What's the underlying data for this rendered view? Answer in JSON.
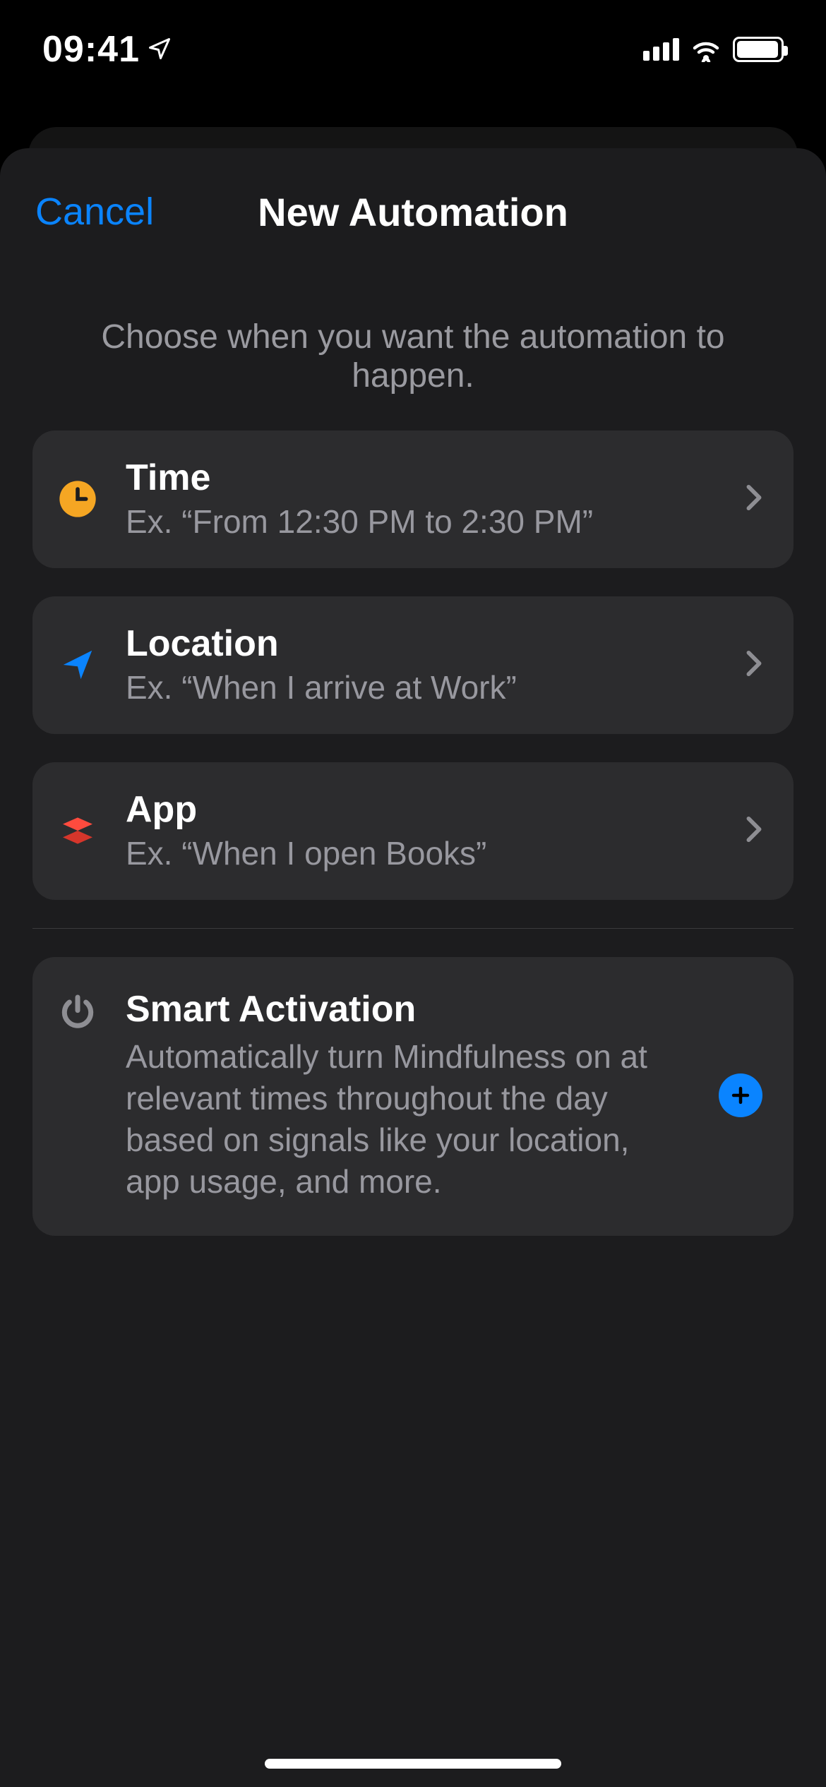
{
  "status": {
    "time": "09:41"
  },
  "nav": {
    "cancel": "Cancel",
    "title": "New Automation"
  },
  "header": "Choose when you want the automation to happen.",
  "rows": {
    "time": {
      "title": "Time",
      "sub": "Ex. “From 12:30 PM to 2:30 PM”"
    },
    "location": {
      "title": "Location",
      "sub": "Ex. “When I arrive at Work”"
    },
    "app": {
      "title": "App",
      "sub": "Ex. “When I open Books”"
    }
  },
  "smart": {
    "title": "Smart Activation",
    "desc": "Automatically turn Mindfulness on at relevant times throughout the day based on signals like your location, app usage, and more."
  },
  "colors": {
    "accent": "#0a84ff",
    "timeIcon": "#f5a623",
    "locationIcon": "#0a84ff",
    "appIcon": "#ff4b3e"
  }
}
